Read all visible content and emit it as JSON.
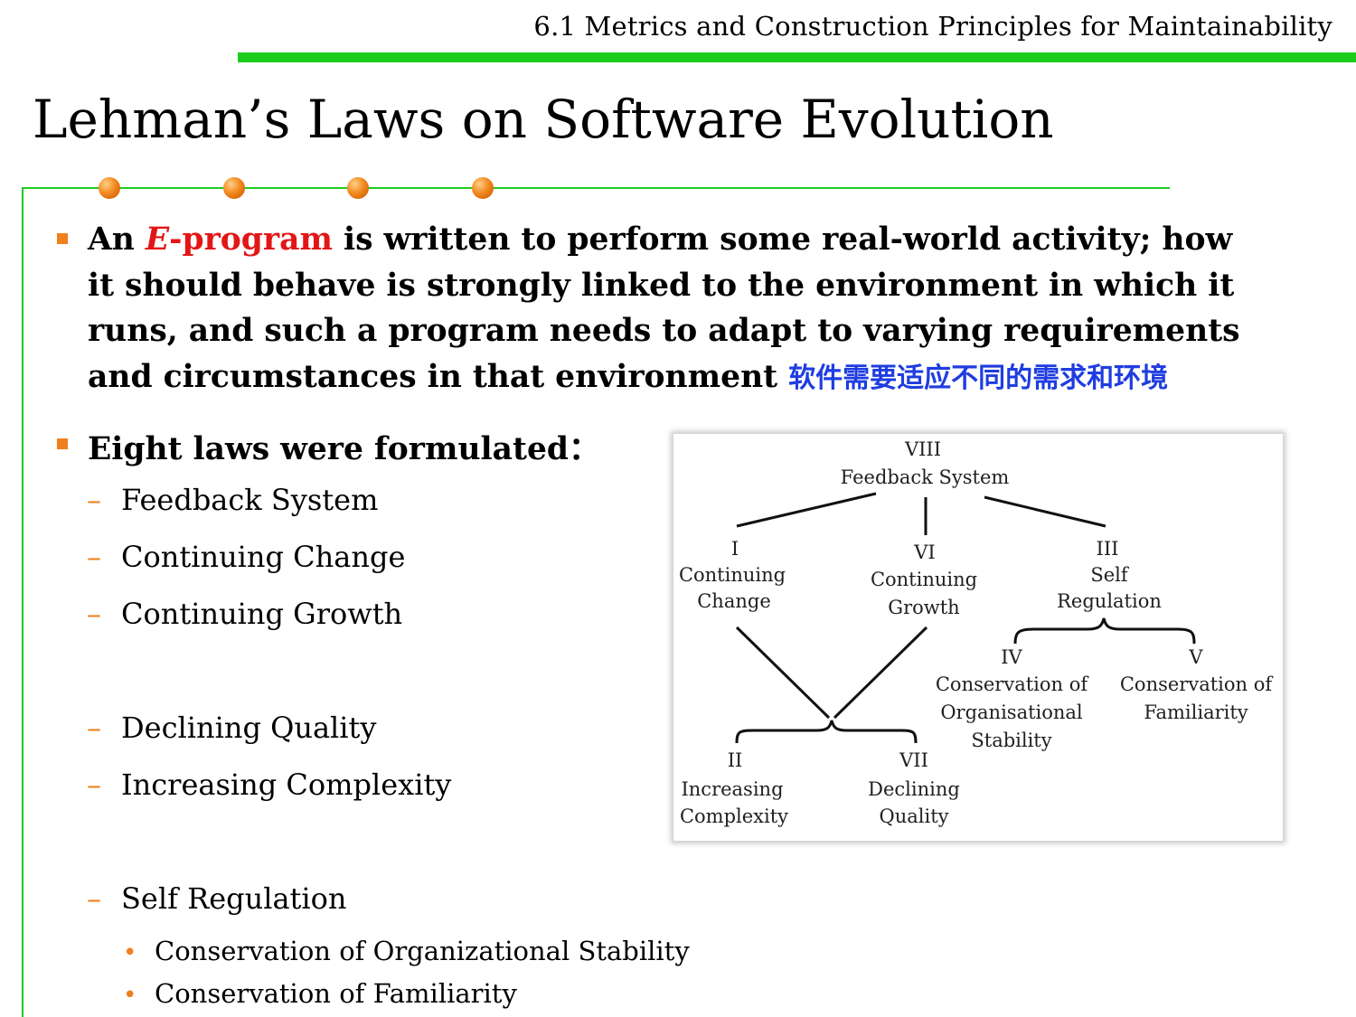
{
  "header": {
    "section_title": "6.1 Metrics and Construction Principles for Maintainability"
  },
  "slide": {
    "title": "Lehman’s Laws on Software Evolution"
  },
  "bullets": {
    "b1": {
      "lead": "An ",
      "eprogram_letter": "E",
      "eprogram_rest": "-program",
      "line1_rest": " is written to perform some real-world activity; how",
      "line2": "it should behave is strongly linked to the environment in which it",
      "line3": "runs, and such a program needs to adapt to varying requirements",
      "line4": "and circumstances in that environment ",
      "chinese_note": "软件需要适应不同的需求和环境"
    },
    "b2": {
      "text": "Eight laws were formulated：",
      "items": [
        "Feedback System",
        "Continuing Change",
        "Continuing Growth",
        "Declining Quality",
        "Increasing Complexity",
        "Self Regulation"
      ],
      "sub_items": [
        "Conservation of Organizational Stability",
        "Conservation of Familiarity"
      ]
    }
  },
  "figure": {
    "nodes": {
      "viii": {
        "numeral": "VIII",
        "label": "Feedback System"
      },
      "i": {
        "numeral": "I",
        "label1": "Continuing",
        "label2": "Change"
      },
      "vi": {
        "numeral": "VI",
        "label1": "Continuing",
        "label2": "Growth"
      },
      "iii": {
        "numeral": "III",
        "label1": "Self",
        "label2": "Regulation"
      },
      "iv": {
        "numeral": "IV",
        "label1": "Conservation of",
        "label2": "Organisational",
        "label3": "Stability"
      },
      "v": {
        "numeral": "V",
        "label1": "Conservation of",
        "label2": "Familiarity"
      },
      "ii": {
        "numeral": "II",
        "label1": "Increasing",
        "label2": "Complexity"
      },
      "vii": {
        "numeral": "VII",
        "label1": "Declining",
        "label2": "Quality"
      }
    }
  }
}
